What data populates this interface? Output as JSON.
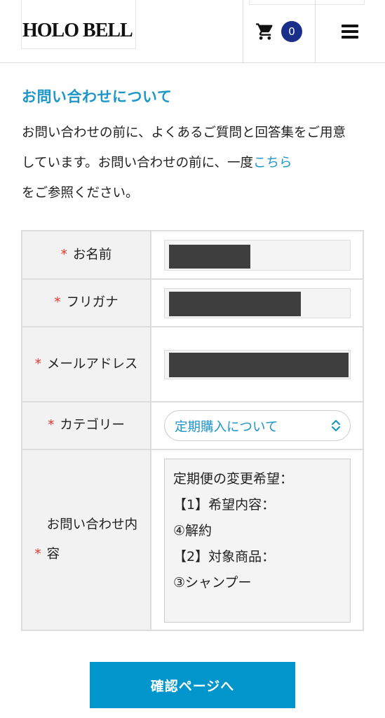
{
  "header": {
    "logo": "HOLO BELL",
    "cart_count": "0",
    "cart_icon": "cart-icon",
    "menu_icon": "hamburger-menu-icon"
  },
  "intro": {
    "title": "お問い合わせについて",
    "text_before_link": "お問い合わせの前に、よくあるご質問と回答集をご用意しています。お問い合わせの前に、一度",
    "link_text": "こちら",
    "text_after_link": "をご参照ください。"
  },
  "form": {
    "required_mark": "*",
    "fields": [
      {
        "label": "お名前",
        "value": "",
        "redacted": true
      },
      {
        "label": "フリガナ",
        "value": "",
        "redacted": true
      },
      {
        "label": "メールアドレス",
        "value": "",
        "redacted": true
      },
      {
        "label": "カテゴリー",
        "selected": "定期購入について"
      },
      {
        "label": "お問い合わせ内容",
        "value": "定期便の変更希望：\n【1】希望内容：\n④解約\n【2】対象商品：\n③シャンプー"
      }
    ]
  },
  "submit_label": "確認ページへ",
  "colors": {
    "accent": "#1e96c8",
    "button": "#0096cc",
    "required": "#e8332b",
    "badge": "#1a2f8a"
  }
}
